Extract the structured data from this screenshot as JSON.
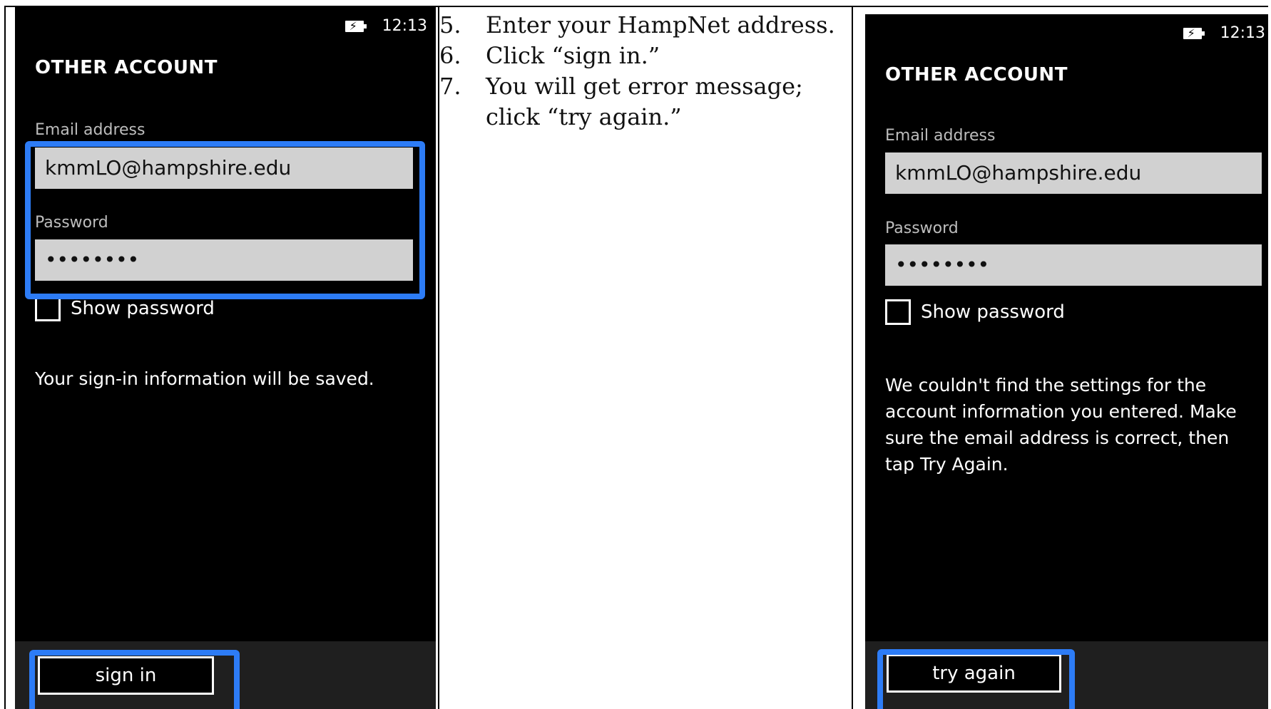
{
  "left_screen": {
    "status": {
      "time": "12:13",
      "battery_icon": "battery-charging-icon"
    },
    "title": "OTHER ACCOUNT",
    "email_label": "Email address",
    "email_value": "kmmLO@hampshire.edu",
    "password_label": "Password",
    "password_value": "••••••••",
    "show_password_label": "Show password",
    "info_text": "Your sign-in information will be saved.",
    "button_label": "sign in"
  },
  "instructions": {
    "steps": [
      {
        "number": "5.",
        "text": "Enter your HampNet address."
      },
      {
        "number": "6.",
        "text": "Click “sign in.”"
      },
      {
        "number": "7.",
        "text": "You will get error message; click “try again.”"
      }
    ]
  },
  "right_screen": {
    "status": {
      "time": "12:13",
      "battery_icon": "battery-charging-icon"
    },
    "title": "OTHER ACCOUNT",
    "email_label": "Email address",
    "email_value": "kmmLO@hampshire.edu",
    "password_label": "Password",
    "password_value": "••••••••",
    "show_password_label": "Show password",
    "error_text": "We couldn't find the settings for the account information you entered. Make sure the email address is correct, then tap Try Again.",
    "button_label": "try again"
  },
  "colors": {
    "highlight": "#2d7cf6",
    "screen_background": "#000000",
    "text_box": "#d1d1d1",
    "app_bar": "#1f1f1f"
  }
}
